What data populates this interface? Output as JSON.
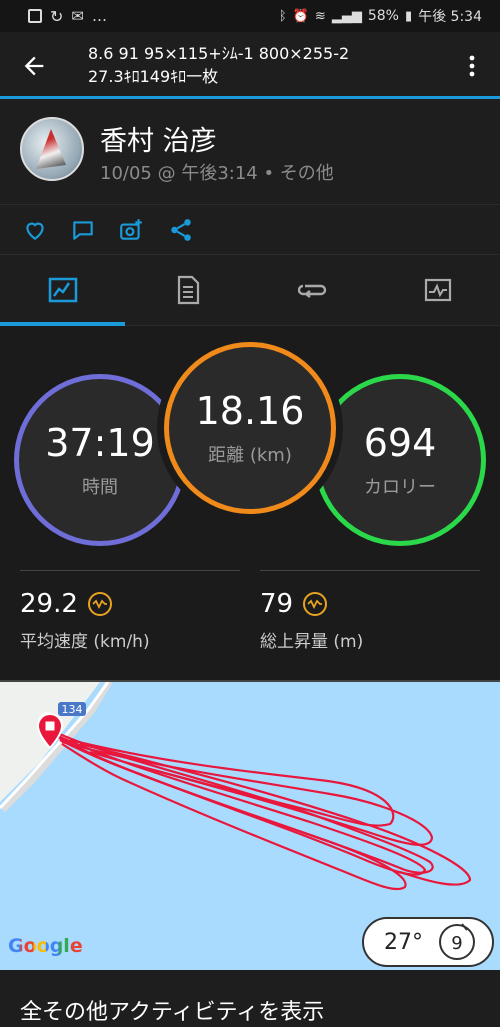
{
  "status_bar": {
    "battery": "58%",
    "time": "午後 5:34",
    "left_icons": [
      "image-icon",
      "sync-icon",
      "mail-icon",
      "more-icon"
    ]
  },
  "header": {
    "title_line1": "8.6 91 95×115+ｼﾑ-1 800×255-2",
    "title_line2": "27.3ｷﾛ149ｷﾛ一枚"
  },
  "profile": {
    "name": "香村 治彦",
    "meta": "10/05 @ 午後3:14 • その他"
  },
  "stats": {
    "time_value": "37:19",
    "time_label": "時間",
    "distance_value": "18.16",
    "distance_label": "距離 (km)",
    "calories_value": "694",
    "calories_label": "カロリー",
    "avg_speed_value": "29.2",
    "avg_speed_label": "平均速度 (km/h)",
    "ascent_value": "79",
    "ascent_label": "総上昇量 (m)"
  },
  "map": {
    "road_label": "134",
    "temperature": "27°",
    "wind": "9",
    "provider": "Google"
  },
  "footer": {
    "text": "全その他アクティビティを表示"
  },
  "colors": {
    "accent": "#1a9ad8",
    "ring_time": "#6f6ed8",
    "ring_distance": "#f08a1a",
    "ring_calories": "#2bd84a",
    "route": "#e8173b"
  }
}
